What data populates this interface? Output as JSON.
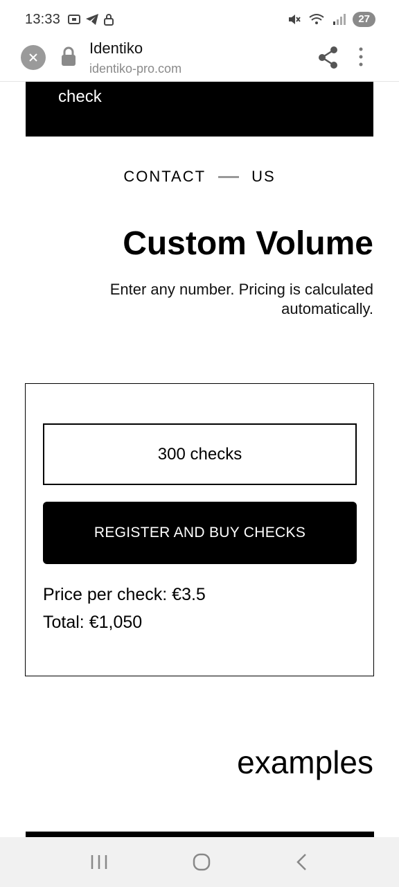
{
  "status_bar": {
    "time": "13:33",
    "battery": "27",
    "icons": [
      "screenshot-icon",
      "telegram-icon",
      "lock-icon",
      "mute-icon",
      "wifi-icon",
      "signal-icon"
    ]
  },
  "browser": {
    "site_title": "Identiko",
    "site_url": "identiko-pro.com"
  },
  "banner": {
    "text": "check"
  },
  "contact": {
    "word1": "CONTACT",
    "word2": "US"
  },
  "custom_volume": {
    "title": "Custom Volume",
    "subtitle": "Enter any number. Pricing is calculated automatically.",
    "input_value": "300 checks",
    "button_label": "REGISTER AND BUY CHECKS",
    "price_per_check": "Price per check: €3.5",
    "total": "Total: €1,050"
  },
  "examples": {
    "title": "examples"
  },
  "colors": {
    "accent": "#000000",
    "muted": "#8a8a8a",
    "nav_bg": "#f1f1f1"
  }
}
